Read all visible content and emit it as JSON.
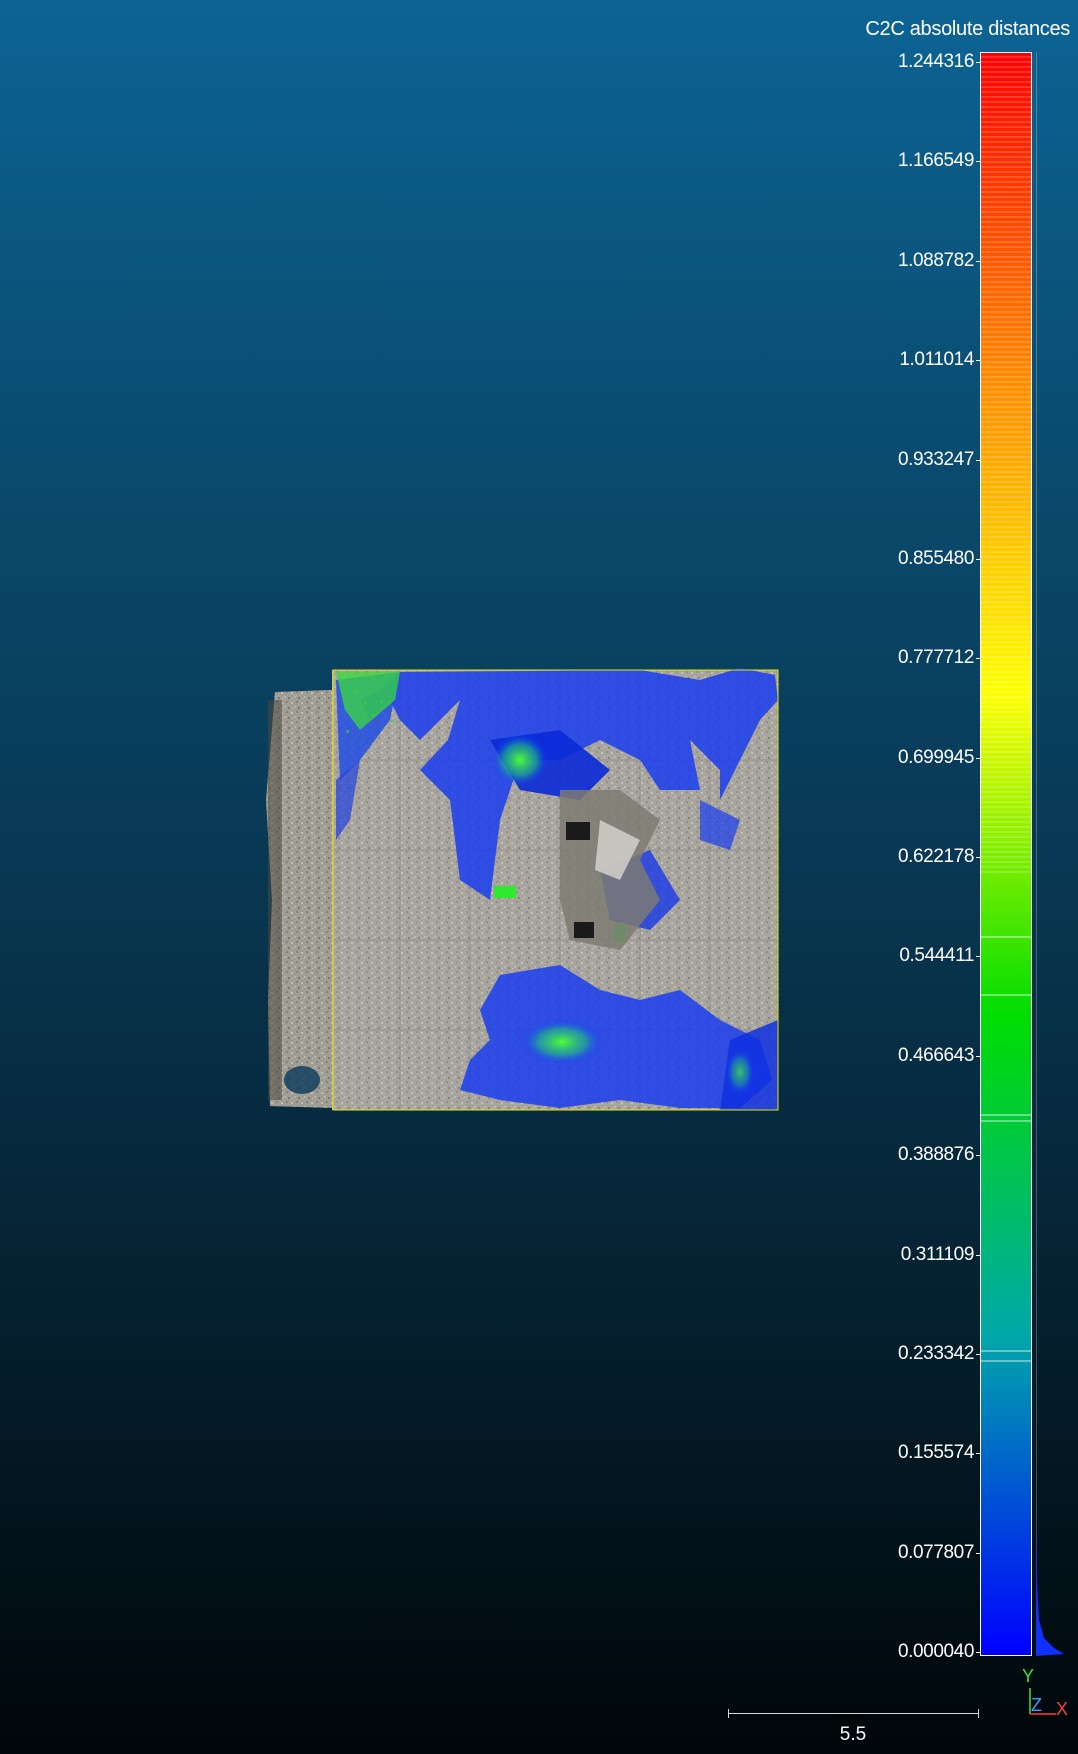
{
  "scalar_bar": {
    "title": "C2C absolute distances",
    "ticks": [
      "1.244316",
      "1.166549",
      "1.088782",
      "1.011014",
      "0.933247",
      "0.855480",
      "0.777712",
      "0.699945",
      "0.622178",
      "0.544411",
      "0.466643",
      "0.388876",
      "0.311109",
      "0.233342",
      "0.155574",
      "0.077807",
      "0.000040"
    ],
    "min": 4e-05,
    "max": 1.244316,
    "color_stops": [
      "#0000ff",
      "#00a8a8",
      "#00dd00",
      "#ffff00",
      "#ff8800",
      "#ff0000"
    ]
  },
  "scale_bar": {
    "label": "5.5"
  },
  "axes": {
    "y_label": "Y",
    "z_label": "Z",
    "x_label": "X",
    "y_color": "#38e838",
    "z_color": "#3aa0ff",
    "x_color": "#ff3b3b"
  },
  "colors": {
    "bbox": "#e6e600",
    "background_top": "#0c6494",
    "background_bottom": "#000609"
  }
}
